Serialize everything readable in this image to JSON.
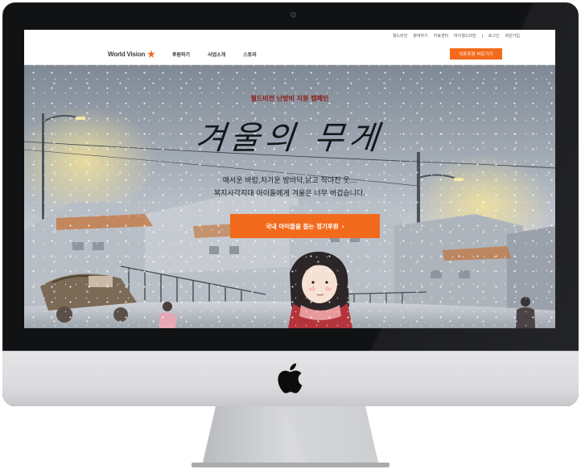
{
  "utility_nav": {
    "items": [
      "월드비전",
      "참여하기",
      "지료센터",
      "마이월드비전"
    ],
    "account": [
      "로그인",
      "회원가입"
    ]
  },
  "header": {
    "logo_text": "World Vision",
    "menu": [
      "후원하기",
      "사업소개",
      "스토리"
    ],
    "cta": "이동후원 바로가기"
  },
  "hero": {
    "campaign": "월드비전 난방비 지원 캠페인",
    "title": "겨울의 무게",
    "desc_line1": "매서운 바람,차가운 방바닥,낡고 작아진 옷...",
    "desc_line2": "복지사각지대 아이들에게 겨울은 너무 버겁습니다.",
    "cta": "국내 아이들을 돕는 정기후원",
    "cta_icon": "chevron-right-icon"
  },
  "colors": {
    "brand_orange": "#f26a1b",
    "campaign_red": "#8a1a12",
    "bezel": "#111214"
  }
}
